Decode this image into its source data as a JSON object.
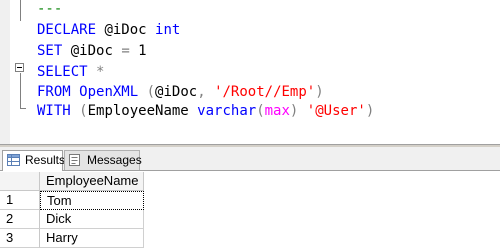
{
  "editor": {
    "lines": [
      {
        "segments": [
          {
            "text": "---",
            "cls": "cm"
          }
        ]
      },
      {
        "segments": [
          {
            "text": "DECLARE",
            "cls": "kw"
          },
          {
            "text": " @iDoc ",
            "cls": ""
          },
          {
            "text": "int",
            "cls": "kw"
          }
        ]
      },
      {
        "segments": [
          {
            "text": "SET",
            "cls": "kw"
          },
          {
            "text": " @iDoc ",
            "cls": ""
          },
          {
            "text": "=",
            "cls": "op"
          },
          {
            "text": " 1",
            "cls": ""
          }
        ]
      },
      {
        "segments": [
          {
            "text": "SELECT",
            "cls": "kw"
          },
          {
            "text": " ",
            "cls": ""
          },
          {
            "text": "*",
            "cls": "op"
          }
        ]
      },
      {
        "segments": [
          {
            "text": "FROM",
            "cls": "kw"
          },
          {
            "text": " ",
            "cls": ""
          },
          {
            "text": "OpenXML",
            "cls": "kw"
          },
          {
            "text": " ",
            "cls": ""
          },
          {
            "text": "(",
            "cls": "op"
          },
          {
            "text": "@iDoc",
            "cls": ""
          },
          {
            "text": ",",
            "cls": "op"
          },
          {
            "text": " ",
            "cls": ""
          },
          {
            "text": "'/Root//Emp'",
            "cls": "str"
          },
          {
            "text": ")",
            "cls": "op"
          }
        ]
      },
      {
        "segments": [
          {
            "text": "WITH",
            "cls": "kw"
          },
          {
            "text": " ",
            "cls": ""
          },
          {
            "text": "(",
            "cls": "op"
          },
          {
            "text": "EmployeeName ",
            "cls": ""
          },
          {
            "text": "varchar",
            "cls": "kw"
          },
          {
            "text": "(",
            "cls": "op"
          },
          {
            "text": "max",
            "cls": "fn"
          },
          {
            "text": ")",
            "cls": "op"
          },
          {
            "text": " ",
            "cls": ""
          },
          {
            "text": "'@User'",
            "cls": "str"
          },
          {
            "text": ")",
            "cls": "op"
          }
        ]
      }
    ]
  },
  "tabs": {
    "results": {
      "label": "Results",
      "icon": "grid-icon"
    },
    "messages": {
      "label": "Messages",
      "icon": "messages-icon"
    }
  },
  "grid": {
    "columns": [
      "EmployeeName"
    ],
    "rows": [
      {
        "num": "1",
        "EmployeeName": "Tom"
      },
      {
        "num": "2",
        "EmployeeName": "Dick"
      },
      {
        "num": "3",
        "EmployeeName": "Harry"
      }
    ]
  },
  "colors": {
    "keyword": "#0000ff",
    "string": "#ff0000",
    "operator": "#808080",
    "function": "#ff00ff",
    "comment": "#008000"
  }
}
